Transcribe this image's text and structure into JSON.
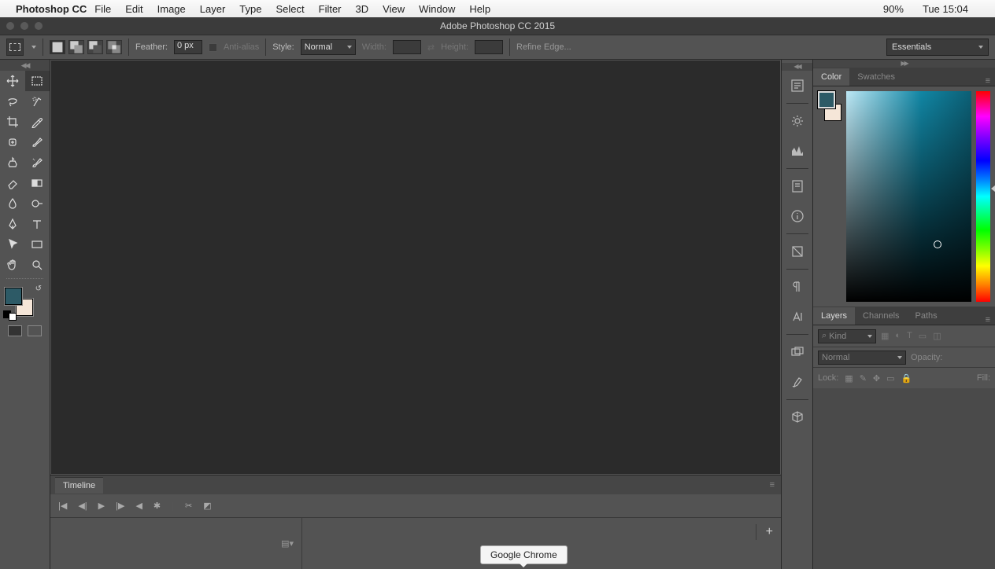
{
  "mac_menu": {
    "app": "Photoshop CC",
    "items": [
      "File",
      "Edit",
      "Image",
      "Layer",
      "Type",
      "Select",
      "Filter",
      "3D",
      "View",
      "Window",
      "Help"
    ],
    "battery": "90%",
    "clock": "Tue 15:04"
  },
  "window": {
    "title": "Adobe Photoshop CC 2015"
  },
  "options_bar": {
    "feather_label": "Feather:",
    "feather_value": "0 px",
    "antialias_label": "Anti-alias",
    "style_label": "Style:",
    "style_value": "Normal",
    "width_label": "Width:",
    "height_label": "Height:",
    "refine_label": "Refine Edge...",
    "workspace": "Essentials"
  },
  "panels": {
    "color_tab": "Color",
    "swatches_tab": "Swatches",
    "layers_tab": "Layers",
    "channels_tab": "Channels",
    "paths_tab": "Paths",
    "timeline_tab": "Timeline"
  },
  "layers": {
    "filter_kind": "Kind",
    "blend_mode": "Normal",
    "opacity_label": "Opacity:",
    "lock_label": "Lock:",
    "fill_label": "Fill:"
  },
  "colors": {
    "foreground": "#2d5a66",
    "background": "#f5e6d8",
    "tool_fg": "#2d5a66",
    "tool_bg": "#f5e6d8"
  },
  "tooltip": {
    "chrome": "Google Chrome"
  },
  "search_icon_char": "⌕"
}
